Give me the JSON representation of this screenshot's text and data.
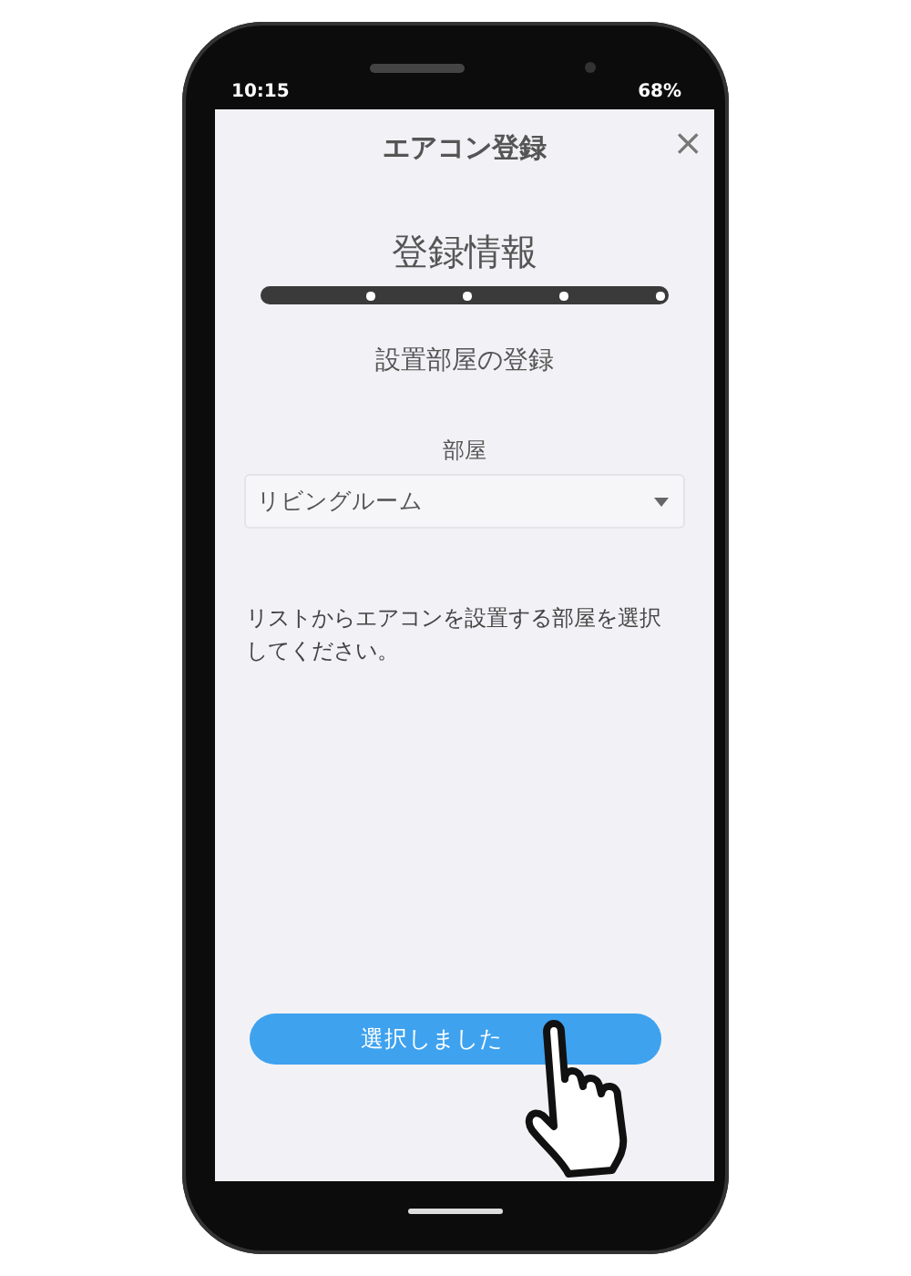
{
  "status_bar": {
    "time": "10:15",
    "battery": "68%"
  },
  "header": {
    "title": "エアコン登録",
    "close": "×"
  },
  "section_title": "登録情報",
  "progress": {
    "level": 1
  },
  "step_title": "設置部屋の登録",
  "room_field": {
    "label": "部屋",
    "value": "リビングルーム"
  },
  "instructions": "リストからエアコンを設置する部屋を選択してください。",
  "confirm_button": "選択しました"
}
